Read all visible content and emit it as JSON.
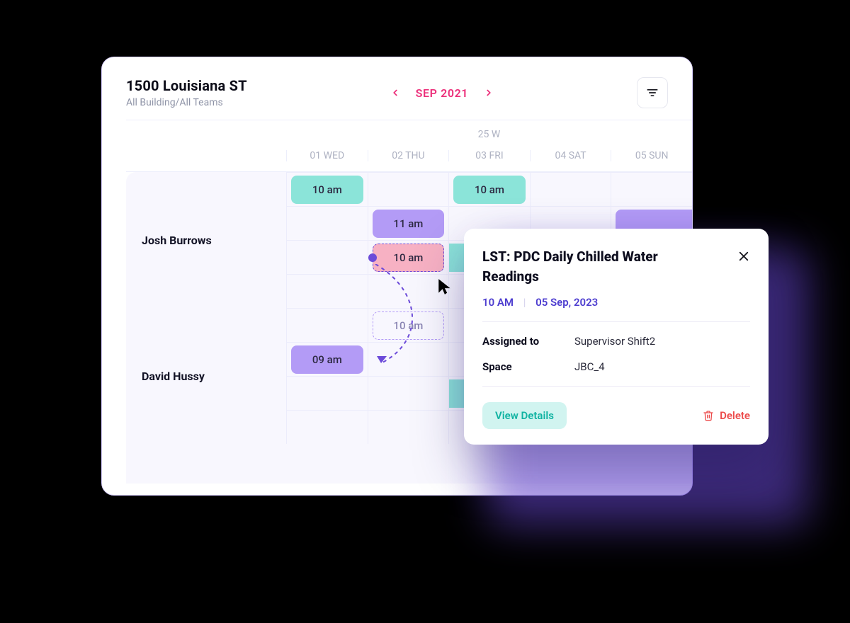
{
  "header": {
    "location_title": "1500 Louisiana ST",
    "location_subtitle": "All Building/All Teams",
    "month_label": "SEP 2021"
  },
  "calendar": {
    "week_label": "25 W",
    "days": [
      "01 WED",
      "02 THU",
      "03 FRI",
      "04 SAT",
      "05 SUN"
    ],
    "people": [
      {
        "name": "Josh Burrows"
      },
      {
        "name": "David Hussy"
      }
    ],
    "events": {
      "josh_r1_c1": "10 am",
      "josh_r1_c3": "10 am",
      "josh_r2_c2": "11 am",
      "josh_r3_c2_drag": "10 am",
      "david_r1_c2_ghost": "10 am",
      "david_r2_c1": "09 am"
    }
  },
  "popup": {
    "title": "LST: PDC Daily Chilled Water Readings",
    "time": "10 AM",
    "date": "05 Sep, 2023",
    "assigned_label": "Assigned to",
    "assigned_value": "Supervisor Shift2",
    "space_label": "Space",
    "space_value": "JBC_4",
    "view_label": "View Details",
    "delete_label": "Delete"
  }
}
